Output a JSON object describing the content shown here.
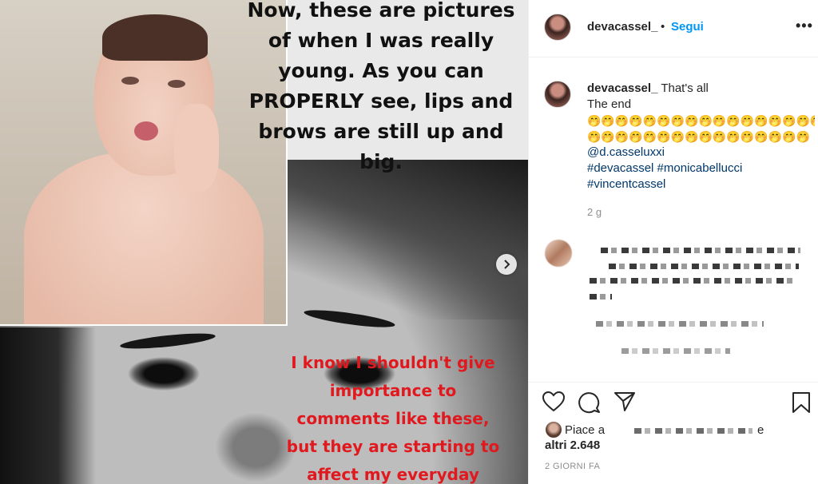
{
  "media": {
    "overlay_top_lines": [
      "Now, these are pictures",
      "of when I was really",
      "young. As you can",
      "PROPERLY see, lips and",
      "brows are still up and",
      "big."
    ],
    "overlay_red_lines": [
      "I know I shouldn't give",
      "importance to",
      "comments like these,",
      "but they are starting to",
      "affect my everyday"
    ],
    "next_icon": "chevron-right-icon"
  },
  "header": {
    "username": "devacassel_",
    "separator": "•",
    "follow_label": "Segui",
    "more_label": "•••"
  },
  "caption": {
    "username": "devacassel_",
    "text": "That's all",
    "line2": "The end",
    "emoji_row1": "🤭🤭🤭🤭🤭🤭🤭🤭🤭🤭🤭🤭🤭🤭🤭🤭🤭",
    "emoji_row2": "🤭🤭🤭🤭🤭🤭🤭🤭🤭🤭🤭🤭🤭🤭🤭🤭",
    "mention": "@d.casseluxxi",
    "hashtags_line1": "#devacassel #monicabellucci",
    "hashtags_line2": "#vincentcassel",
    "age": "2 g"
  },
  "footer": {
    "liked_prefix": "Piace a",
    "liked_suffix": "e",
    "liked_others": "altri 2.648",
    "posted_ago": "2 GIORNI FA"
  },
  "icons": [
    "heart-icon",
    "comment-icon",
    "share-icon",
    "bookmark-icon"
  ]
}
